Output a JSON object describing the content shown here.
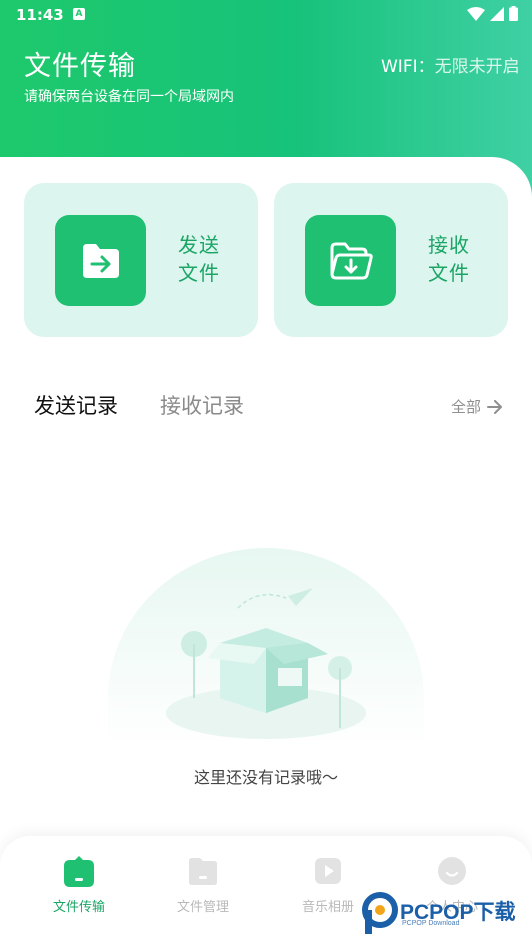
{
  "status_bar": {
    "time": "11:43",
    "a_badge": "A"
  },
  "header": {
    "title": "文件传输",
    "subtitle": "请确保两台设备在同一个局域网内",
    "wifi_label": "WIFI：",
    "wifi_value": "无限未开启"
  },
  "actions": {
    "send": {
      "label_line1": "发送",
      "label_line2": "文件",
      "icon": "folder-send-icon"
    },
    "receive": {
      "label_line1": "接收",
      "label_line2": "文件",
      "icon": "folder-receive-icon"
    }
  },
  "tabs": {
    "send_records": "发送记录",
    "receive_records": "接收记录",
    "all": "全部"
  },
  "empty_state": {
    "message": "这里还没有记录哦～"
  },
  "bottom_nav": [
    {
      "label": "文件传输",
      "icon": "home-folder-icon",
      "active": true
    },
    {
      "label": "文件管理",
      "icon": "file-manager-icon",
      "active": false
    },
    {
      "label": "音乐相册",
      "icon": "music-album-icon",
      "active": false
    },
    {
      "label": "个人中心",
      "icon": "profile-icon",
      "active": false
    }
  ],
  "watermark": {
    "brand": "PCPOP下载",
    "sub": "PCPOP Download"
  },
  "colors": {
    "primary": "#1fc072",
    "card_bg": "#ddf5ef",
    "label_green": "#1aa565"
  }
}
